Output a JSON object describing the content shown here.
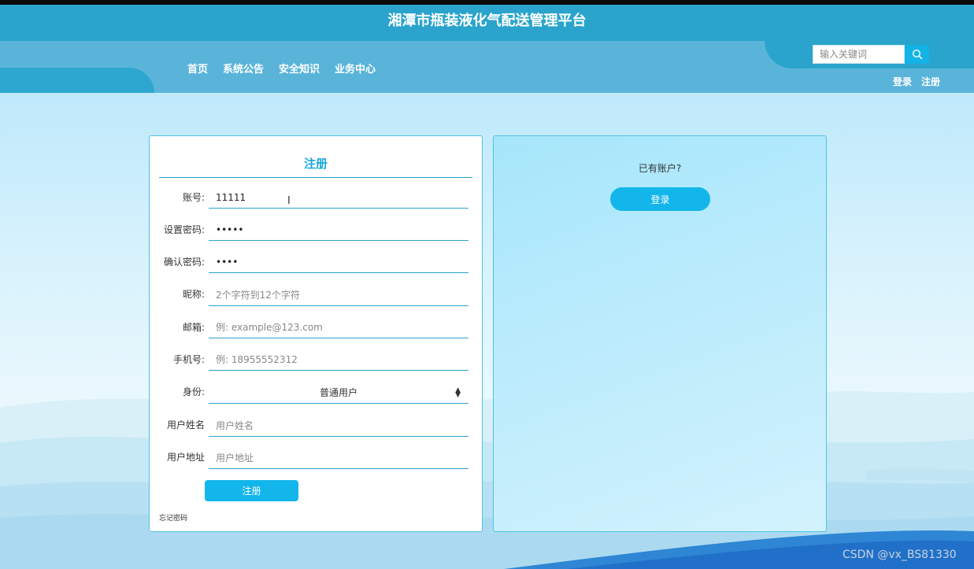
{
  "header": {
    "site_title": "湘潭市瓶装液化气配送管理平台",
    "nav": [
      {
        "label": "首页"
      },
      {
        "label": "系统公告"
      },
      {
        "label": "安全知识"
      },
      {
        "label": "业务中心"
      }
    ],
    "search": {
      "placeholder": "输入关键词",
      "value": ""
    },
    "auth": {
      "login": "登录",
      "register": "注册"
    }
  },
  "register_form": {
    "title": "注册",
    "fields": [
      {
        "label": "账号:",
        "value": "11111",
        "placeholder": "",
        "type": "text"
      },
      {
        "label": "设置密码:",
        "value": "11111",
        "placeholder": "",
        "type": "password"
      },
      {
        "label": "确认密码:",
        "value": "1111",
        "placeholder": "",
        "type": "password"
      },
      {
        "label": "昵称:",
        "value": "",
        "placeholder": "2个字符到12个字符",
        "type": "text"
      },
      {
        "label": "邮箱:",
        "value": "",
        "placeholder": "例: example@123.com",
        "type": "text"
      },
      {
        "label": "手机号:",
        "value": "",
        "placeholder": "例: 18955552312",
        "type": "text"
      }
    ],
    "identity": {
      "label": "身份:",
      "selected": "普通用户"
    },
    "name_field": {
      "label": "用户姓名",
      "value": "",
      "placeholder": "用户姓名"
    },
    "address_field": {
      "label": "用户地址",
      "value": "",
      "placeholder": "用户地址"
    },
    "submit_label": "注册",
    "forgot_label": "忘记密码"
  },
  "login_panel": {
    "prompt": "已有账户?",
    "button_label": "登录"
  },
  "watermark": "CSDN @vx_BS81330",
  "colors": {
    "title_band": "#2aa4cc",
    "nav_band": "#5ab4d9",
    "accent": "#13b6ea",
    "panel_border": "#4ec1e6"
  },
  "icons": {
    "search": "search-icon",
    "select_arrows": "sort-arrows-icon",
    "text_cursor": "text-cursor-icon"
  }
}
